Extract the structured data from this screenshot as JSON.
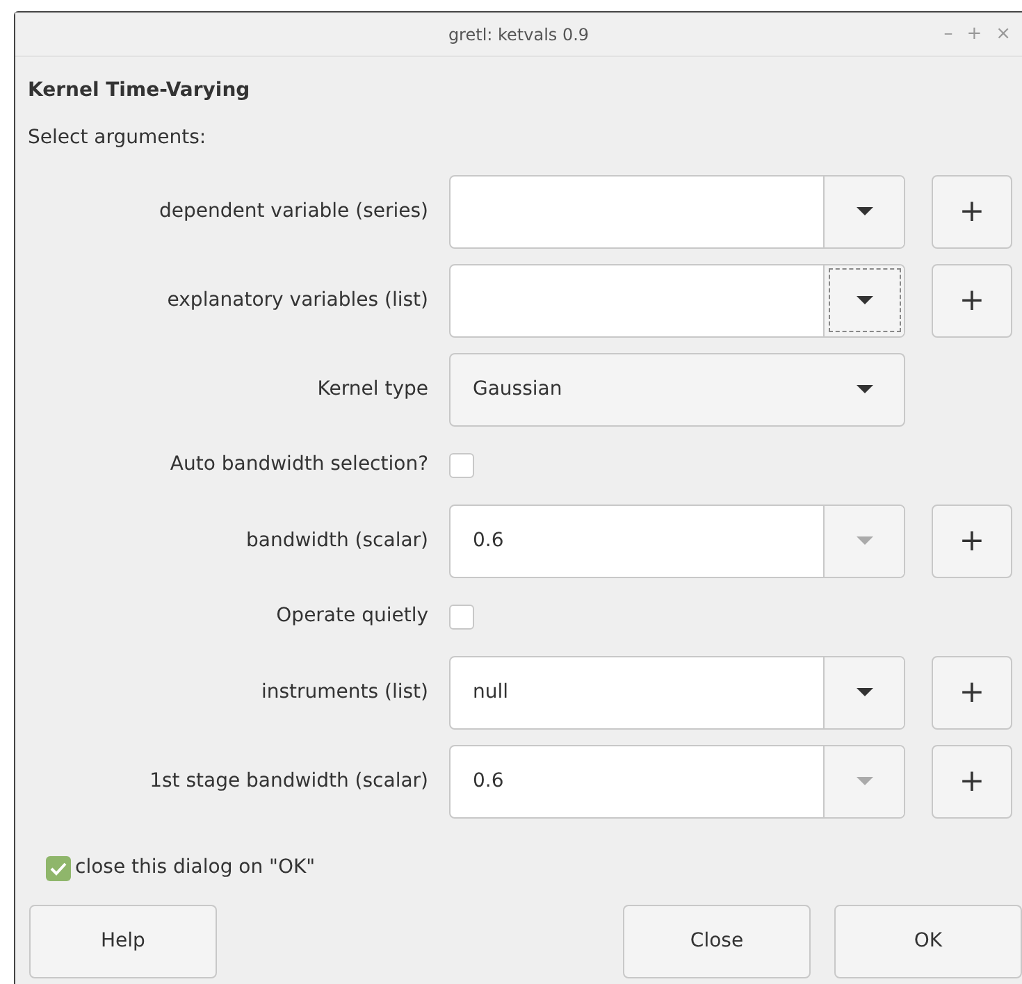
{
  "window": {
    "title": "gretl: ketvals 0.9",
    "controls": [
      "–",
      "+",
      "×"
    ]
  },
  "heading": "Kernel Time-Varying",
  "prompt": "Select arguments:",
  "rows": [
    {
      "kind": "combo",
      "label": "dependent variable (series)",
      "value": "",
      "arrow_enabled": true,
      "arrow_focused": false,
      "add_button": "+"
    },
    {
      "kind": "combo",
      "label": "explanatory variables (list)",
      "value": "",
      "arrow_enabled": true,
      "arrow_focused": true,
      "add_button": "+"
    },
    {
      "kind": "select",
      "label": "Kernel type",
      "value": "Gaussian"
    },
    {
      "kind": "checkbox",
      "label": "Auto bandwidth selection?",
      "checked": false
    },
    {
      "kind": "combo",
      "label": "bandwidth (scalar)",
      "value": "0.6",
      "arrow_enabled": false,
      "arrow_focused": false,
      "add_button": "+"
    },
    {
      "kind": "checkbox",
      "label": "Operate quietly",
      "checked": false
    },
    {
      "kind": "combo",
      "label": "instruments (list)",
      "value": "null",
      "arrow_enabled": true,
      "arrow_focused": false,
      "add_button": "+"
    },
    {
      "kind": "combo",
      "label": "1st stage bandwidth (scalar)",
      "value": "0.6",
      "arrow_enabled": false,
      "arrow_focused": false,
      "add_button": "+"
    }
  ],
  "close_on_ok": {
    "label": "close this dialog on \"OK\"",
    "checked": true
  },
  "buttons": [
    "Help",
    "Close",
    "OK"
  ]
}
